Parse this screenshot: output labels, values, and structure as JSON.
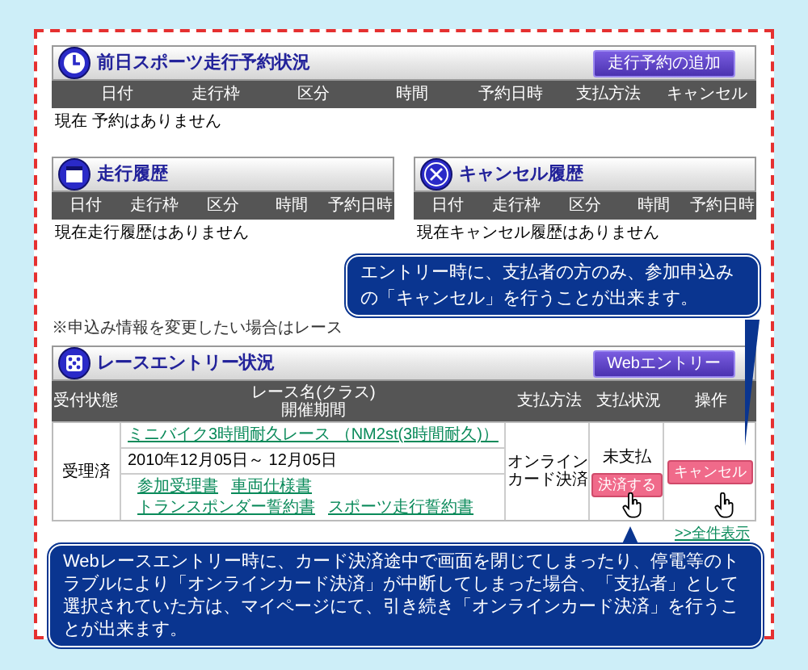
{
  "reservation_status": {
    "title": "前日スポーツ走行予約状況",
    "button": "走行予約の追加",
    "columns": [
      "日付",
      "走行枠",
      "区分",
      "時間",
      "予約日時",
      "支払方法",
      "キャンセル"
    ],
    "empty_message": "現在 予約はありません"
  },
  "history_panels": [
    {
      "title": "走行履歴",
      "columns": [
        "日付",
        "走行枠",
        "区分",
        "時間",
        "予約日時"
      ],
      "empty_message": "現在走行履歴はありません"
    },
    {
      "title": "キャンセル履歴",
      "columns": [
        "日付",
        "走行枠",
        "区分",
        "時間",
        "予約日時"
      ],
      "empty_message": "現在キャンセル履歴はありません"
    }
  ],
  "note": "※申込み情報を変更したい場合はレース",
  "race_entry": {
    "title": "レースエントリー状況",
    "button": "Webエントリー",
    "columns": [
      [
        "受付状態"
      ],
      [
        "レース名(クラス)",
        "開催期間"
      ],
      [
        "支払方法"
      ],
      [
        "支払状況"
      ],
      [
        "操作"
      ]
    ],
    "rows": [
      {
        "status": "受理済",
        "race_name": "ミニバイク3時間耐久レース （NM2st(3時間耐久)）",
        "period": "2010年12月05日～ 12月05日",
        "documents": [
          "参加受理書",
          "車両仕様書",
          "トランスポンダー誓約書",
          "スポーツ走行誓約書"
        ],
        "payment_method": [
          "オンライン",
          "カード決済"
        ],
        "payment_status": "未支払",
        "pay_button": "決済する",
        "cancel_button": "キャンセル"
      }
    ],
    "show_all_link": ">>全件表示"
  },
  "callouts": [
    {
      "text": "エントリー時に、支払者の方のみ、参加申込みの「キャンセル」を行うことが出来ます。"
    },
    {
      "text": "Webレースエントリー時に、カード決済途中で画面を閉じてしまったり、停電等のトラブルにより「オンラインカード決済」が中断してしまった場合、「支払者」として選択されていた方は、マイページにて、引き続き「オンラインカード決済」を行うことが出来ます。"
    }
  ]
}
